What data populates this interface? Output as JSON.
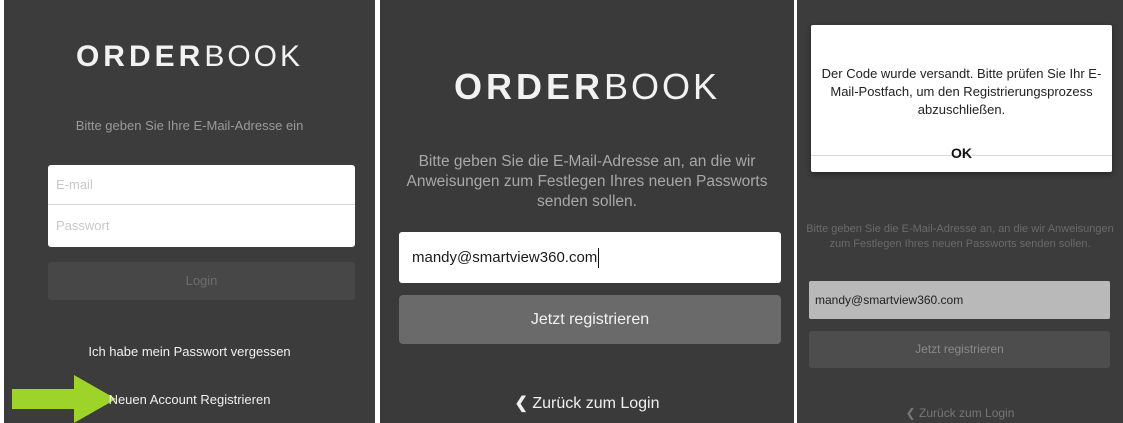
{
  "logo": {
    "bold": "ORDER",
    "light": "BOOK"
  },
  "login_screen": {
    "prompt": "Bitte geben Sie Ihre E-Mail-Adresse ein",
    "email_placeholder": "E-mail",
    "password_placeholder": "Passwort",
    "login_label": "Login",
    "forgot_link": "Ich habe mein Passwort vergessen",
    "register_link": "Neuen Account Registrieren"
  },
  "register_screen": {
    "prompt": "Bitte geben Sie die E-Mail-Adresse an, an die wir Anweisungen zum Festlegen Ihres neuen Passworts senden sollen.",
    "email_value": "mandy@smartview360.com",
    "register_button": "Jetzt registrieren",
    "back_link": "Zurück zum Login"
  },
  "confirm_screen": {
    "dialog_message": "Der Code wurde versandt. Bitte prüfen Sie Ihr E-Mail-Postfach, um den Registrierungsprozess abzuschließen.",
    "ok_label": "OK",
    "prompt": "Bitte geben Sie die E-Mail-Adresse an, an die wir Anweisungen zum Festlegen Ihres neuen Passworts senden sollen.",
    "email_value": "mandy@smartview360.com",
    "register_button": "Jetzt registrieren",
    "back_link": "Zurück zum Login"
  },
  "icons": {
    "arrow": "right-arrow-icon",
    "back": "chevron-left-icon"
  },
  "colors": {
    "arrow": "#9ed42a",
    "panel_bg": "#3c3c3c"
  }
}
